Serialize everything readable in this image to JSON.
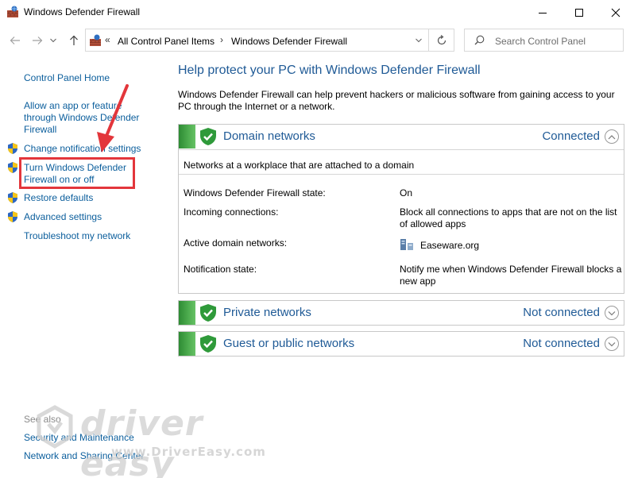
{
  "window": {
    "title": "Windows Defender Firewall",
    "minimize_icon": "minimize-icon",
    "maximize_icon": "maximize-icon",
    "close_icon": "close-icon"
  },
  "nav": {
    "breadcrumb_overflow": "«",
    "crumbs": [
      "All Control Panel Items",
      "Windows Defender Firewall"
    ],
    "separator": "›",
    "search_placeholder": "Search Control Panel"
  },
  "sidebar": {
    "home": "Control Panel Home",
    "items": [
      {
        "label": "Allow an app or feature through Windows Defender Firewall",
        "shield": false
      },
      {
        "label": "Change notification settings",
        "shield": true
      },
      {
        "label": "Turn Windows Defender Firewall on or off",
        "shield": true,
        "highlighted": true
      },
      {
        "label": "Restore defaults",
        "shield": true
      },
      {
        "label": "Advanced settings",
        "shield": true
      },
      {
        "label": "Troubleshoot my network",
        "shield": false
      }
    ],
    "see_also_title": "See also",
    "see_also": [
      "Security and Maintenance",
      "Network and Sharing Center"
    ]
  },
  "main": {
    "title": "Help protect your PC with Windows Defender Firewall",
    "description": "Windows Defender Firewall can help prevent hackers or malicious software from gaining access to your PC through the Internet or a network.",
    "networks": [
      {
        "name": "Domain networks",
        "status": "Connected",
        "expanded": true,
        "description": "Networks at a workplace that are attached to a domain",
        "details": [
          {
            "label": "Windows Defender Firewall state:",
            "value": "On"
          },
          {
            "label": "Incoming connections:",
            "value": "Block all connections to apps that are not on the list of allowed apps"
          },
          {
            "label": "Active domain networks:",
            "value": "Easeware.org"
          },
          {
            "label": "Notification state:",
            "value": "Notify me when Windows Defender Firewall blocks a new app"
          }
        ]
      },
      {
        "name": "Private networks",
        "status": "Not connected",
        "expanded": false
      },
      {
        "name": "Guest or public networks",
        "status": "Not connected",
        "expanded": false
      }
    ]
  },
  "watermark": {
    "text": "driver easy",
    "url": "www.DriverEasy.com"
  },
  "colors": {
    "link": "#0b5e9c",
    "heading": "#1f5a96",
    "green": "#3a9d3f",
    "annotation": "#e3363b"
  }
}
